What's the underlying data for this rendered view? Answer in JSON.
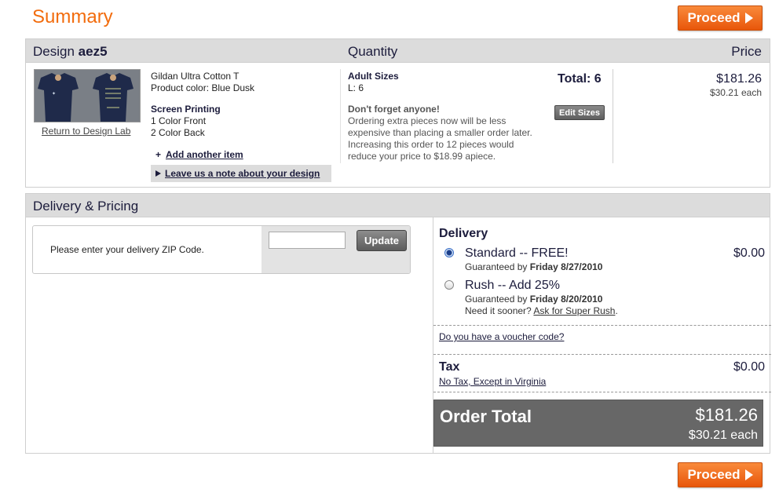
{
  "page": {
    "title": "Summary",
    "proceed_label": "Proceed"
  },
  "summary": {
    "header": {
      "design_prefix": "Design",
      "design_name": "aez5",
      "quantity": "Quantity",
      "price": "Price"
    },
    "return_link": "Return to Design Lab",
    "product": {
      "name": "Gildan Ultra Cotton T",
      "color": "Product color: Blue Dusk",
      "method": "Screen Printing",
      "front": "1 Color Front",
      "back": "2 Color Back"
    },
    "add_item": "Add another item",
    "note_link": "Leave us a note about your design",
    "sizes_title": "Adult Sizes",
    "sizes_value": "L: 6",
    "total_qty": "Total: 6",
    "edit_sizes": "Edit Sizes",
    "dont_forget_title": "Don't forget anyone!",
    "dont_forget_text": "Ordering extra pieces now will be less expensive than placing a smaller order later. Increasing this order to 12 pieces would reduce your price to $18.99 apiece.",
    "price_total": "$181.26",
    "price_each": "$30.21 each"
  },
  "delivery_pricing": {
    "header": "Delivery & Pricing",
    "zip_prompt": "Please enter your delivery ZIP Code.",
    "zip_value": "",
    "update_label": "Update",
    "delivery_title": "Delivery",
    "options": [
      {
        "name": "Standard -- FREE!",
        "guarantee_prefix": "Guaranteed by",
        "guarantee_date": "Friday 8/27/2010",
        "price": "$0.00",
        "selected": true
      },
      {
        "name": "Rush -- Add 25%",
        "guarantee_prefix": "Guaranteed by",
        "guarantee_date": "Friday 8/20/2010",
        "sooner_prefix": "Need it sooner?",
        "sooner_link": "Ask for Super Rush",
        "selected": false
      }
    ],
    "voucher_link": "Do you have a voucher code?",
    "tax_title": "Tax",
    "tax_note": "No Tax, Except in Virginia",
    "tax_price": "$0.00",
    "order_total_label": "Order Total",
    "order_total_price": "$181.26",
    "order_total_each": "$30.21 each"
  },
  "colors": {
    "accent": "#f26c0d",
    "navy": "#1c1c3c",
    "header_gray": "#dcdcdc",
    "total_bar": "#676767"
  }
}
